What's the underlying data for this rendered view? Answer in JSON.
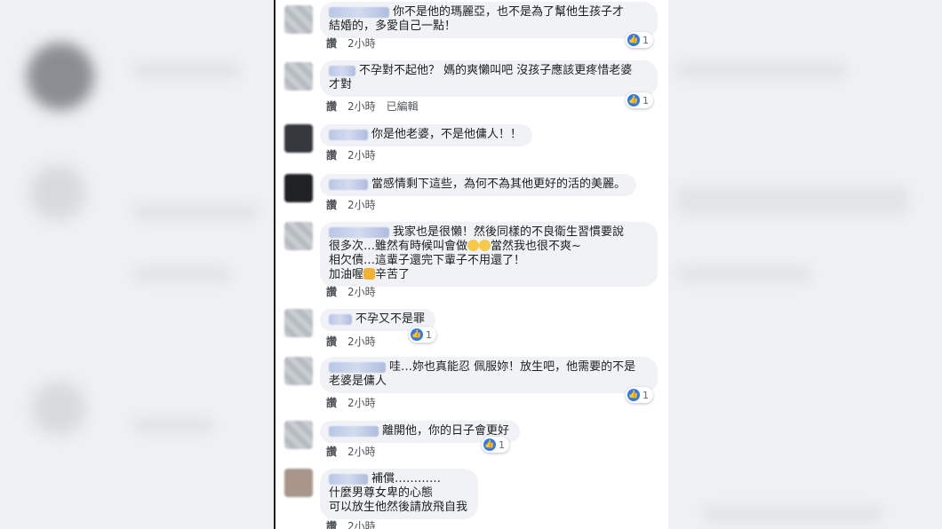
{
  "labels": {
    "like": "讚"
  },
  "comments": [
    {
      "text": "你不是他的瑪麗亞，也不是為了幫他生孩子才\n結婚的，多愛自己一點！",
      "time": "2小時",
      "edited": "",
      "reactions": "1"
    },
    {
      "text": "不孕對不起他？ 媽的爽懶叫吧 沒孩子應該更疼惜老婆\n才對",
      "time": "2小時",
      "edited": "已編輯",
      "reactions": "1"
    },
    {
      "text": "你是他老婆，不是他傭人！！",
      "time": "2小時",
      "edited": "",
      "reactions": ""
    },
    {
      "text": "當感情剩下這些，為何不為其他更好的活的美麗。",
      "time": "2小時",
      "edited": "",
      "reactions": ""
    },
    {
      "text_line1": "我家也是很懶！然後同樣的不良衛生習慣要說",
      "text_line2a": "很多次…雖然有時候叫會做",
      "text_line2b": "當然我也很不爽~",
      "text_line3": "相欠債…這輩子還完下輩子不用還了！",
      "text_line4a": "加油喔",
      "text_line4b": "辛苦了",
      "time": "2小時",
      "edited": "",
      "reactions": ""
    },
    {
      "text": "不孕又不是罪",
      "time": "2小時",
      "edited": "",
      "reactions": "1"
    },
    {
      "text": "哇…妳也真能忍 佩服妳！放生吧，他需要的不是\n老婆是傭人",
      "time": "2小時",
      "edited": "",
      "reactions": "1"
    },
    {
      "text": "離開他，你的日子會更好",
      "time": "2小時",
      "edited": "",
      "reactions": "1"
    },
    {
      "text": "補償…………\n什麼男尊女卑的心態\n可以放生他然後請放飛自我",
      "time": "2小時",
      "edited": "",
      "reactions": ""
    }
  ],
  "colors": {
    "bubble": "#f0f2f5",
    "like_blue": "#2e7bf0",
    "border": "#1c1e21"
  }
}
